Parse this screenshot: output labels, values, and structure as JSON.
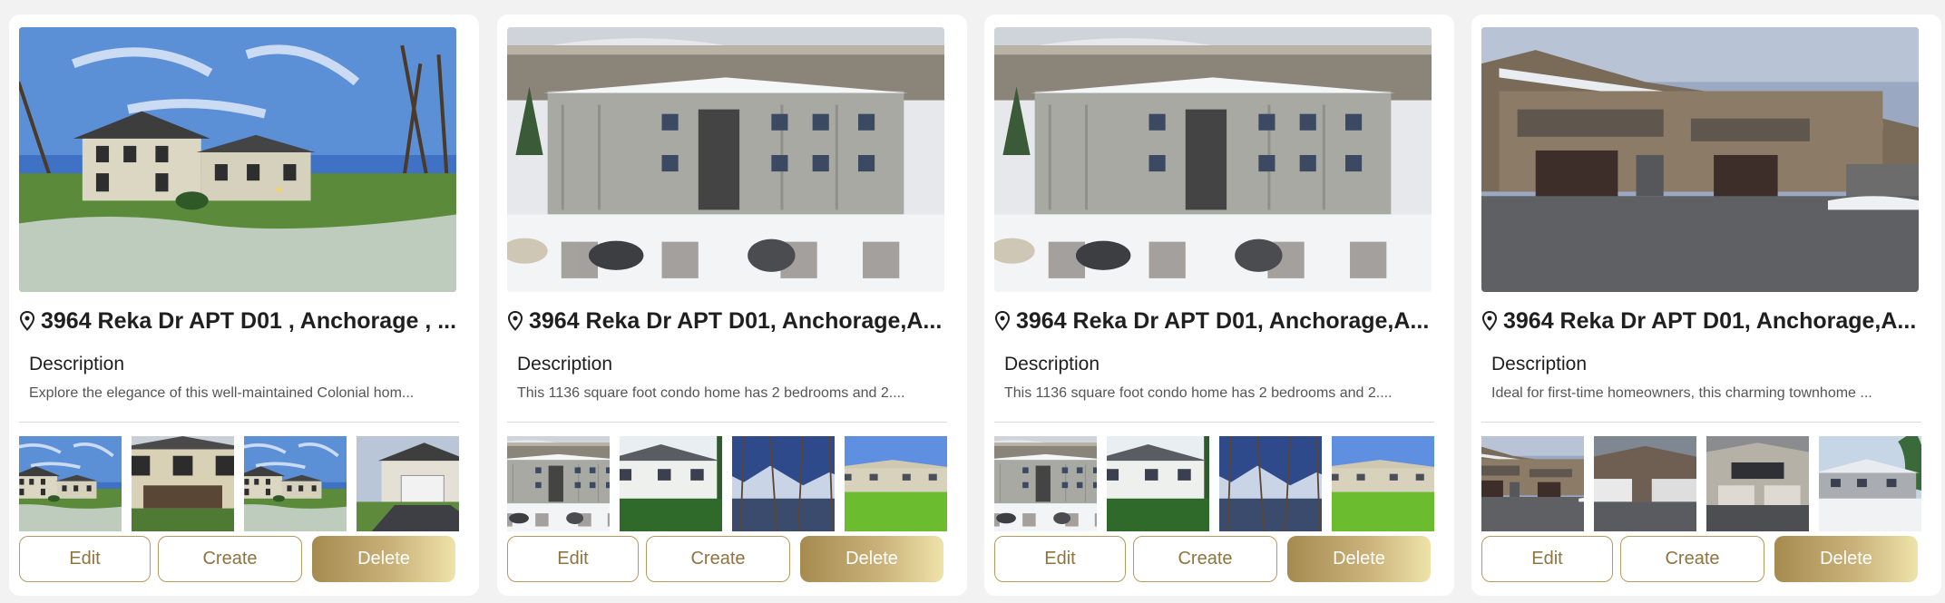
{
  "colors": {
    "accent": "#b59a5d",
    "accent_text": "#8d7440",
    "delete_gradient": [
      "#a68b50",
      "#c9b179",
      "#efe3a9"
    ],
    "page_background": "#f2f2f2"
  },
  "icons": {
    "location": "map-pin-icon"
  },
  "cards": [
    {
      "address": "3964 Reka Dr APT D01 , Anchorage , ...",
      "description_heading": "Description",
      "description": "Explore the elegance of this well-maintained Colonial hom...",
      "buttons": {
        "edit": "Edit",
        "create": "Create",
        "delete": "Delete"
      }
    },
    {
      "address": "3964 Reka Dr APT D01, Anchorage,A...",
      "description_heading": "Description",
      "description": "This 1136 square foot condo home has 2 bedrooms and 2....",
      "buttons": {
        "edit": "Edit",
        "create": "Create",
        "delete": "Delete"
      }
    },
    {
      "address": "3964 Reka Dr APT D01, Anchorage,A...",
      "description_heading": "Description",
      "description": "This 1136 square foot condo home has 2 bedrooms and 2....",
      "buttons": {
        "edit": "Edit",
        "create": "Create",
        "delete": "Delete"
      }
    },
    {
      "address": "3964 Reka Dr APT D01, Anchorage,A...",
      "description_heading": "Description",
      "description": "Ideal for first-time homeowners, this charming townhome ...",
      "buttons": {
        "edit": "Edit",
        "create": "Create",
        "delete": "Delete"
      }
    }
  ]
}
